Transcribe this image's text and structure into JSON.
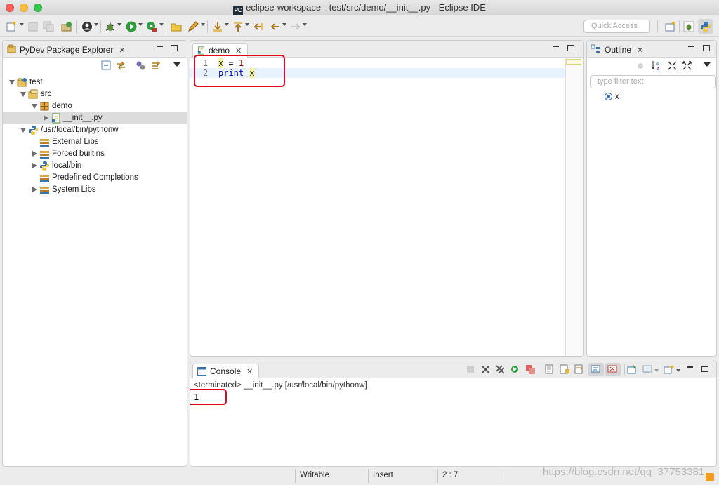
{
  "window": {
    "title": "eclipse-workspace - test/src/demo/__init__.py - Eclipse IDE",
    "app_icon_text": "PC"
  },
  "toolbar": {
    "quick_access_placeholder": "Quick Access"
  },
  "explorer": {
    "tab_label": "PyDev Package Explorer",
    "items": [
      {
        "label": "test",
        "icon": "project-icon",
        "expanded": true
      },
      {
        "label": "src",
        "icon": "source-folder-icon",
        "expanded": true
      },
      {
        "label": "demo",
        "icon": "package-icon",
        "expanded": true
      },
      {
        "label": "__init__.py",
        "icon": "python-file-icon",
        "expanded": false
      },
      {
        "label": "/usr/local/bin/pythonw",
        "icon": "python-icon",
        "expanded": true
      },
      {
        "label": "External Libs",
        "icon": "library-icon",
        "expanded": null
      },
      {
        "label": "Forced builtins",
        "icon": "library-icon",
        "expanded": false
      },
      {
        "label": "local/bin",
        "icon": "python-icon",
        "expanded": false
      },
      {
        "label": "Predefined Completions",
        "icon": "library-icon",
        "expanded": null
      },
      {
        "label": "System Libs",
        "icon": "library-icon",
        "expanded": false
      }
    ]
  },
  "editor": {
    "tab_label": "demo",
    "lines": [
      {
        "num": "1",
        "var": "x",
        "rest": " = ",
        "value": "1"
      },
      {
        "num": "2",
        "keyword": "print",
        "space": " ",
        "var": "x"
      }
    ]
  },
  "outline": {
    "tab_label": "Outline",
    "filter_placeholder": "type filter text",
    "items": [
      {
        "label": "x"
      }
    ]
  },
  "console": {
    "tab_label": "Console",
    "status": "<terminated> __init__.py [/usr/local/bin/pythonw]",
    "output": "1"
  },
  "statusbar": {
    "writable": "Writable",
    "insert_mode": "Insert",
    "position": "2 : 7",
    "watermark": "https://blog.csdn.net/qq_37753381"
  },
  "colors": {
    "annotation_box": "#e8001c",
    "keyword": "#7f0055",
    "number": "#8b0000",
    "highlight": "#f4f3a6"
  }
}
